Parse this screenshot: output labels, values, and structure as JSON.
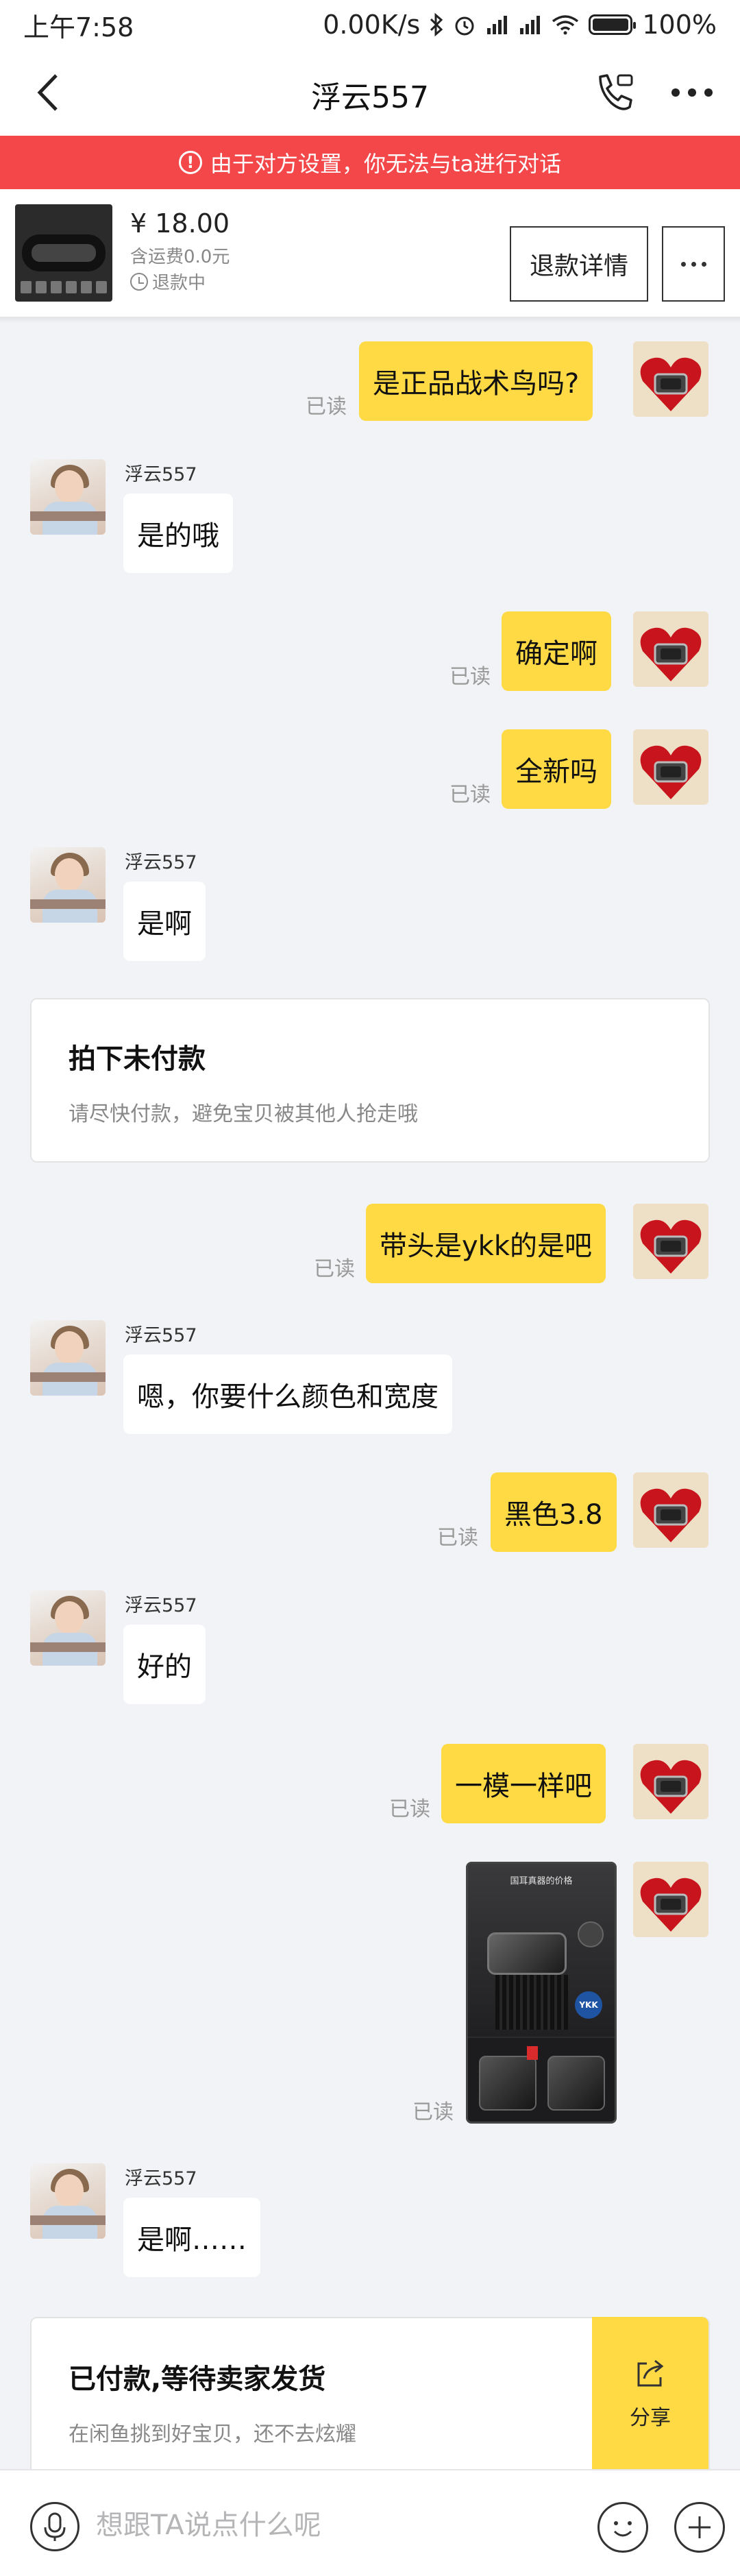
{
  "status_bar": {
    "time": "上午7:58",
    "network_speed": "0.00K/s",
    "battery": "100%"
  },
  "nav": {
    "title": "浮云557"
  },
  "banner": {
    "text": "由于对方设置，你无法与ta进行对话"
  },
  "product": {
    "price": "¥ 18.00",
    "shipping": "含运费0.0元",
    "status": "退款中",
    "refund_button": "退款详情"
  },
  "messages": [
    {
      "text": "是正品战术鸟吗?",
      "read": "已读"
    },
    {
      "sender": "浮云557",
      "text": "是的哦"
    },
    {
      "text": "确定啊",
      "read": "已读"
    },
    {
      "text": "全新吗",
      "read": "已读"
    },
    {
      "sender": "浮云557",
      "text": "是啊"
    },
    {
      "text": "带头是ykk的是吧",
      "read": "已读"
    },
    {
      "sender": "浮云557",
      "text": "嗯，你要什么颜色和宽度"
    },
    {
      "text": "黑色3.8",
      "read": "已读"
    },
    {
      "sender": "浮云557",
      "text": "好的"
    },
    {
      "text": "一模一样吧",
      "read": "已读"
    },
    {
      "read": "已读"
    },
    {
      "sender": "浮云557",
      "text": "是啊……"
    }
  ],
  "image_message": {
    "heading": "国耳真器的价格",
    "badge": "YKK"
  },
  "card_unpaid": {
    "title": "拍下未付款",
    "subtitle": "请尽快付款，避免宝贝被其他人抢走哦"
  },
  "card_paid": {
    "title": "已付款,等待卖家发货",
    "subtitle": "在闲鱼挑到好宝贝，还不去炫耀",
    "share_label": "分享"
  },
  "input": {
    "placeholder": "想跟TA说点什么呢"
  },
  "colors": {
    "banner": "#f4474a",
    "my_bubble": "#ffda44",
    "background": "#f2f3f6"
  }
}
